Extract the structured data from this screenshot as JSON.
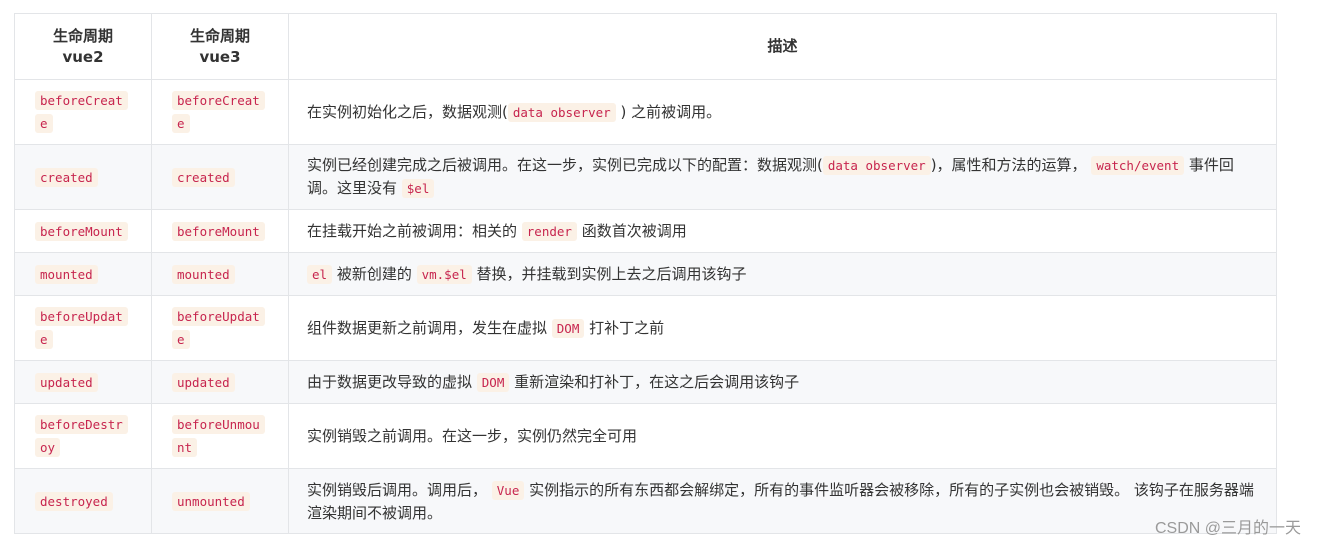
{
  "headers": {
    "col1_line1": "生命周期",
    "col1_line2": "vue2",
    "col2_line1": "生命周期",
    "col2_line2": "vue3",
    "col3": "描述"
  },
  "rows": [
    {
      "vue2": "beforeCreate",
      "vue3": "beforeCreate",
      "desc": [
        {
          "t": "在实例初始化之后，数据观测("
        },
        {
          "c": "data observer"
        },
        {
          "t": " ) 之前被调用。"
        }
      ]
    },
    {
      "vue2": "created",
      "vue3": "created",
      "desc": [
        {
          "t": "实例已经创建完成之后被调用。在这一步，实例已完成以下的配置：数据观测("
        },
        {
          "c": "data observer"
        },
        {
          "t": ")，属性和方法的运算， "
        },
        {
          "c": "watch/event"
        },
        {
          "t": " 事件回调。这里没有 "
        },
        {
          "c": "$el"
        }
      ]
    },
    {
      "vue2": "beforeMount",
      "vue3": "beforeMount",
      "desc": [
        {
          "t": "在挂载开始之前被调用：相关的 "
        },
        {
          "c": "render"
        },
        {
          "t": " 函数首次被调用"
        }
      ]
    },
    {
      "vue2": "mounted",
      "vue3": "mounted",
      "desc": [
        {
          "c": "el"
        },
        {
          "t": " 被新创建的 "
        },
        {
          "c": "vm.$el"
        },
        {
          "t": " 替换，并挂载到实例上去之后调用该钩子"
        }
      ]
    },
    {
      "vue2": "beforeUpdate",
      "vue3": "beforeUpdate",
      "desc": [
        {
          "t": "组件数据更新之前调用，发生在虚拟 "
        },
        {
          "c": "DOM"
        },
        {
          "t": " 打补丁之前"
        }
      ]
    },
    {
      "vue2": "updated",
      "vue3": "updated",
      "desc": [
        {
          "t": "由于数据更改导致的虚拟 "
        },
        {
          "c": "DOM"
        },
        {
          "t": " 重新渲染和打补丁，在这之后会调用该钩子"
        }
      ]
    },
    {
      "vue2": "beforeDestroy",
      "vue3": "beforeUnmount",
      "desc": [
        {
          "t": "实例销毁之前调用。在这一步，实例仍然完全可用"
        }
      ]
    },
    {
      "vue2": "destroyed",
      "vue3": "unmounted",
      "desc": [
        {
          "t": "实例销毁后调用。调用后， "
        },
        {
          "c": "Vue"
        },
        {
          "t": " 实例指示的所有东西都会解绑定，所有的事件监听器会被移除，所有的子实例也会被销毁。 该钩子在服务器端渲染期间不被调用。"
        }
      ]
    }
  ],
  "watermark": "CSDN @三月的一天"
}
